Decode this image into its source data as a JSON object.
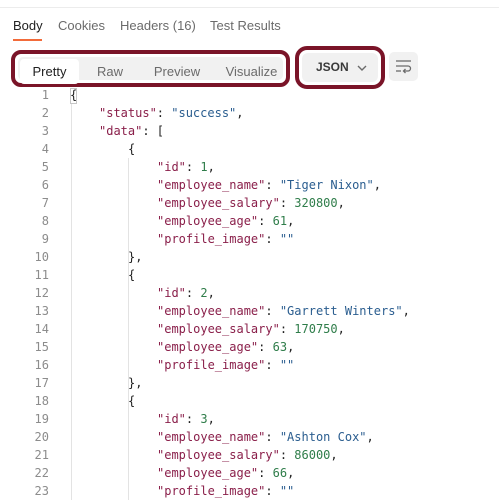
{
  "tabs": [
    {
      "label": "Body",
      "active": true
    },
    {
      "label": "Cookies",
      "active": false
    },
    {
      "label": "Headers (16)",
      "active": false
    },
    {
      "label": "Test Results",
      "active": false
    }
  ],
  "view_modes": [
    {
      "label": "Pretty",
      "active": true
    },
    {
      "label": "Raw",
      "active": false
    },
    {
      "label": "Preview",
      "active": false
    },
    {
      "label": "Visualize",
      "active": false
    }
  ],
  "language": {
    "label": "JSON",
    "icon": "chevron-down-icon"
  },
  "wrap_icon": "wrap-lines-icon",
  "colors": {
    "accent": "#f26b3a",
    "highlight_border": "#7a1428",
    "key": "#8a1f4a",
    "string": "#2a5d8f",
    "number": "#2f7d4a"
  },
  "code_lines": [
    {
      "num": "1",
      "indent": 0,
      "tokens": [
        {
          "t": "p",
          "v": "{"
        }
      ]
    },
    {
      "num": "2",
      "indent": 1,
      "tokens": [
        {
          "t": "k",
          "v": "\"status\""
        },
        {
          "t": "p",
          "v": ": "
        },
        {
          "t": "s",
          "v": "\"success\""
        },
        {
          "t": "p",
          "v": ","
        }
      ]
    },
    {
      "num": "3",
      "indent": 1,
      "tokens": [
        {
          "t": "k",
          "v": "\"data\""
        },
        {
          "t": "p",
          "v": ": ["
        }
      ]
    },
    {
      "num": "4",
      "indent": 2,
      "tokens": [
        {
          "t": "p",
          "v": "{"
        }
      ]
    },
    {
      "num": "5",
      "indent": 3,
      "tokens": [
        {
          "t": "k",
          "v": "\"id\""
        },
        {
          "t": "p",
          "v": ": "
        },
        {
          "t": "n",
          "v": "1"
        },
        {
          "t": "p",
          "v": ","
        }
      ]
    },
    {
      "num": "6",
      "indent": 3,
      "tokens": [
        {
          "t": "k",
          "v": "\"employee_name\""
        },
        {
          "t": "p",
          "v": ": "
        },
        {
          "t": "s",
          "v": "\"Tiger Nixon\""
        },
        {
          "t": "p",
          "v": ","
        }
      ]
    },
    {
      "num": "7",
      "indent": 3,
      "tokens": [
        {
          "t": "k",
          "v": "\"employee_salary\""
        },
        {
          "t": "p",
          "v": ": "
        },
        {
          "t": "n",
          "v": "320800"
        },
        {
          "t": "p",
          "v": ","
        }
      ]
    },
    {
      "num": "8",
      "indent": 3,
      "tokens": [
        {
          "t": "k",
          "v": "\"employee_age\""
        },
        {
          "t": "p",
          "v": ": "
        },
        {
          "t": "n",
          "v": "61"
        },
        {
          "t": "p",
          "v": ","
        }
      ]
    },
    {
      "num": "9",
      "indent": 3,
      "tokens": [
        {
          "t": "k",
          "v": "\"profile_image\""
        },
        {
          "t": "p",
          "v": ": "
        },
        {
          "t": "s",
          "v": "\"\""
        }
      ]
    },
    {
      "num": "10",
      "indent": 2,
      "tokens": [
        {
          "t": "p",
          "v": "},"
        }
      ]
    },
    {
      "num": "11",
      "indent": 2,
      "tokens": [
        {
          "t": "p",
          "v": "{"
        }
      ]
    },
    {
      "num": "12",
      "indent": 3,
      "tokens": [
        {
          "t": "k",
          "v": "\"id\""
        },
        {
          "t": "p",
          "v": ": "
        },
        {
          "t": "n",
          "v": "2"
        },
        {
          "t": "p",
          "v": ","
        }
      ]
    },
    {
      "num": "13",
      "indent": 3,
      "tokens": [
        {
          "t": "k",
          "v": "\"employee_name\""
        },
        {
          "t": "p",
          "v": ": "
        },
        {
          "t": "s",
          "v": "\"Garrett Winters\""
        },
        {
          "t": "p",
          "v": ","
        }
      ]
    },
    {
      "num": "14",
      "indent": 3,
      "tokens": [
        {
          "t": "k",
          "v": "\"employee_salary\""
        },
        {
          "t": "p",
          "v": ": "
        },
        {
          "t": "n",
          "v": "170750"
        },
        {
          "t": "p",
          "v": ","
        }
      ]
    },
    {
      "num": "15",
      "indent": 3,
      "tokens": [
        {
          "t": "k",
          "v": "\"employee_age\""
        },
        {
          "t": "p",
          "v": ": "
        },
        {
          "t": "n",
          "v": "63"
        },
        {
          "t": "p",
          "v": ","
        }
      ]
    },
    {
      "num": "16",
      "indent": 3,
      "tokens": [
        {
          "t": "k",
          "v": "\"profile_image\""
        },
        {
          "t": "p",
          "v": ": "
        },
        {
          "t": "s",
          "v": "\"\""
        }
      ]
    },
    {
      "num": "17",
      "indent": 2,
      "tokens": [
        {
          "t": "p",
          "v": "},"
        }
      ]
    },
    {
      "num": "18",
      "indent": 2,
      "tokens": [
        {
          "t": "p",
          "v": "{"
        }
      ]
    },
    {
      "num": "19",
      "indent": 3,
      "tokens": [
        {
          "t": "k",
          "v": "\"id\""
        },
        {
          "t": "p",
          "v": ": "
        },
        {
          "t": "n",
          "v": "3"
        },
        {
          "t": "p",
          "v": ","
        }
      ]
    },
    {
      "num": "20",
      "indent": 3,
      "tokens": [
        {
          "t": "k",
          "v": "\"employee_name\""
        },
        {
          "t": "p",
          "v": ": "
        },
        {
          "t": "s",
          "v": "\"Ashton Cox\""
        },
        {
          "t": "p",
          "v": ","
        }
      ]
    },
    {
      "num": "21",
      "indent": 3,
      "tokens": [
        {
          "t": "k",
          "v": "\"employee_salary\""
        },
        {
          "t": "p",
          "v": ": "
        },
        {
          "t": "n",
          "v": "86000"
        },
        {
          "t": "p",
          "v": ","
        }
      ]
    },
    {
      "num": "22",
      "indent": 3,
      "tokens": [
        {
          "t": "k",
          "v": "\"employee_age\""
        },
        {
          "t": "p",
          "v": ": "
        },
        {
          "t": "n",
          "v": "66"
        },
        {
          "t": "p",
          "v": ","
        }
      ]
    },
    {
      "num": "23",
      "indent": 3,
      "tokens": [
        {
          "t": "k",
          "v": "\"profile_image\""
        },
        {
          "t": "p",
          "v": ": "
        },
        {
          "t": "s",
          "v": "\"\""
        }
      ]
    }
  ]
}
